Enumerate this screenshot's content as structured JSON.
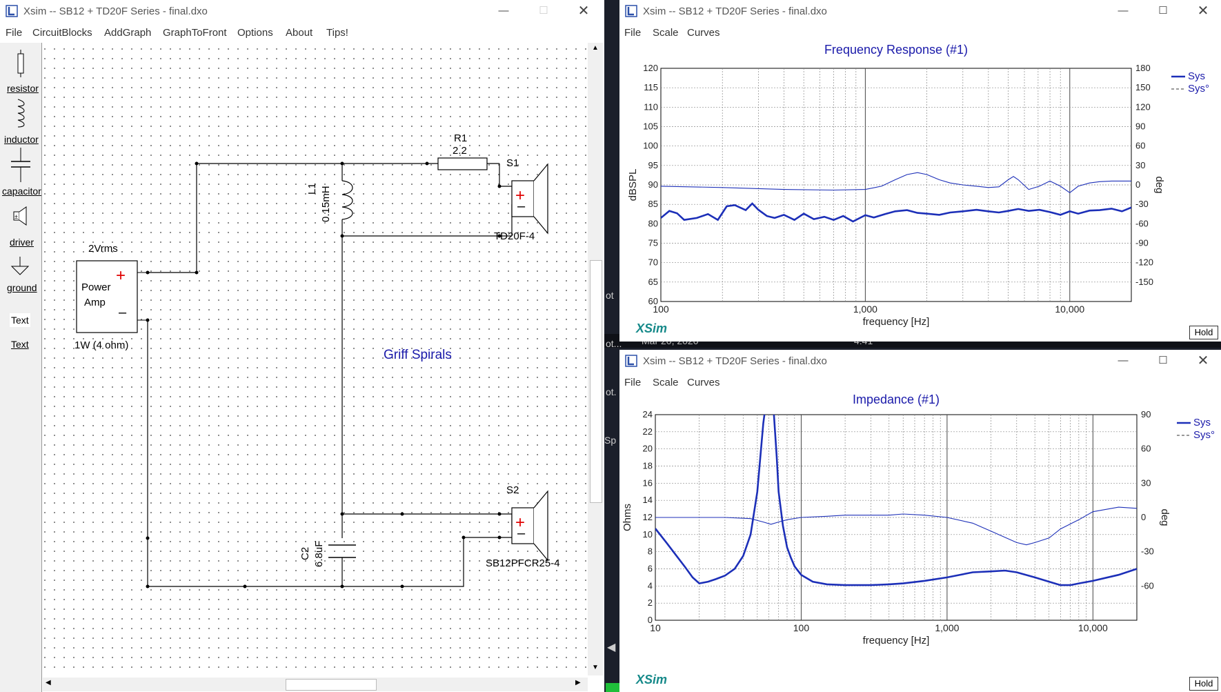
{
  "left_window": {
    "title": "Xsim -- SB12 + TD20F Series - final.dxo",
    "menu": [
      "File",
      "CircuitBlocks",
      "AddGraph",
      "GraphToFront",
      "Options",
      "About",
      "Tips!"
    ],
    "palette": [
      "resistor",
      "inductor",
      "capacitor",
      "driver",
      "ground",
      "Text",
      "Text"
    ],
    "circuit": {
      "r1_name": "R1",
      "r1_value": "2.2",
      "l1_name": "L1",
      "l1_value": "0.15mH",
      "c2_name": "C2",
      "c2_value": "6.8uF",
      "s1_name": "S1",
      "s1_model": "TD20F-4",
      "s2_name": "S2",
      "s2_model": "SB12PFCR25-4",
      "amp_voltage": "2Vrms",
      "amp_line1": "Power",
      "amp_line2": "Amp",
      "amp_power": "1W (4 ohm)",
      "plus": "+",
      "minus": "–",
      "annotation": "Griff Spirals"
    }
  },
  "freq_window": {
    "title": "Xsim -- SB12 + TD20F Series - final.dxo",
    "menu": [
      "File",
      "Scale",
      "Curves"
    ],
    "logo": "XSim",
    "hold": "Hold"
  },
  "imp_window": {
    "title": "Xsim -- SB12 + TD20F Series - final.dxo",
    "menu": [
      "File",
      "Scale",
      "Curves"
    ],
    "logo": "XSim",
    "hold": "Hold"
  },
  "background_text": {
    "date": "Mar 20, 2020",
    "time": "4:41",
    "frag1": "ot",
    "frag2": "ot...",
    "frag3": "ot.",
    "frag4": "Sp"
  },
  "colors": {
    "accent": "#1a1aaa",
    "curve": "#1c2fb8",
    "plus": "#e00000"
  },
  "chart_data": [
    {
      "type": "line",
      "title": "Frequency Response (#1)",
      "xlabel": "frequency [Hz]",
      "ylabel": "dBSPL",
      "y2label": "deg",
      "xscale": "log",
      "xlim": [
        100,
        20000
      ],
      "ylim": [
        60,
        120
      ],
      "y2lim": [
        -180,
        180
      ],
      "xticks": [
        {
          "v": 100,
          "label": "100"
        },
        {
          "v": 1000,
          "label": "1,000"
        },
        {
          "v": 10000,
          "label": "10,000"
        }
      ],
      "yticks": [
        60,
        65,
        70,
        75,
        80,
        85,
        90,
        95,
        100,
        105,
        110,
        115,
        120
      ],
      "y2ticks": [
        -150,
        -120,
        -90,
        -60,
        -30,
        0,
        30,
        60,
        90,
        120,
        150,
        180
      ],
      "grid": true,
      "legend": "top-right",
      "series": [
        {
          "name": "Sys",
          "axis": "left",
          "style": "solid",
          "x": [
            100,
            110,
            120,
            130,
            150,
            170,
            190,
            210,
            230,
            260,
            280,
            300,
            330,
            360,
            400,
            450,
            500,
            560,
            630,
            700,
            780,
            870,
            1000,
            1100,
            1250,
            1400,
            1600,
            1800,
            2000,
            2300,
            2600,
            3000,
            3500,
            4000,
            4500,
            5000,
            5600,
            6300,
            7100,
            8000,
            9000,
            10000,
            11000,
            12500,
            14000,
            16000,
            18000,
            20000
          ],
          "y": [
            81.5,
            83.3,
            82.7,
            81.0,
            81.5,
            82.5,
            81.0,
            84.5,
            84.8,
            83.5,
            85.2,
            83.6,
            82.0,
            81.5,
            82.3,
            81.0,
            82.6,
            81.2,
            81.8,
            81.0,
            82.0,
            80.6,
            82.2,
            81.6,
            82.5,
            83.2,
            83.5,
            82.8,
            82.6,
            82.3,
            82.9,
            83.2,
            83.6,
            83.2,
            82.9,
            83.3,
            83.8,
            83.3,
            83.6,
            83.0,
            82.3,
            83.2,
            82.6,
            83.4,
            83.5,
            83.9,
            83.2,
            84.2
          ]
        },
        {
          "name": "Sys°",
          "axis": "right",
          "style": "dashed",
          "x": [
            100,
            200,
            400,
            700,
            1000,
            1200,
            1400,
            1600,
            1800,
            2000,
            2300,
            2600,
            3000,
            3500,
            4000,
            4500,
            5000,
            5300,
            5600,
            6300,
            7100,
            8000,
            9000,
            10000,
            11000,
            12500,
            14000,
            16000,
            20000
          ],
          "y": [
            -2,
            -4,
            -7,
            -8,
            -7,
            -2,
            8,
            16,
            19,
            16,
            8,
            3,
            0,
            -2,
            -4,
            -3,
            8,
            13,
            8,
            -7,
            -2,
            6,
            -2,
            -12,
            -2,
            3,
            5,
            6,
            6
          ]
        }
      ]
    },
    {
      "type": "line",
      "title": "Impedance (#1)",
      "xlabel": "frequency [Hz]",
      "ylabel": "Ohms",
      "y2label": "deg",
      "xscale": "log",
      "xlim": [
        10,
        20000
      ],
      "ylim": [
        0,
        24
      ],
      "y2lim": [
        -90,
        90
      ],
      "xticks": [
        {
          "v": 10,
          "label": "10"
        },
        {
          "v": 100,
          "label": "100"
        },
        {
          "v": 1000,
          "label": "1,000"
        },
        {
          "v": 10000,
          "label": "10,000"
        }
      ],
      "yticks": [
        0,
        2,
        4,
        6,
        8,
        10,
        12,
        14,
        16,
        18,
        20,
        22,
        24
      ],
      "y2ticks": [
        -60,
        -30,
        0,
        30,
        60,
        90
      ],
      "grid": true,
      "legend": "top-right",
      "series": [
        {
          "name": "Sys",
          "axis": "left",
          "style": "solid",
          "x": [
            10,
            12,
            14,
            16,
            18,
            20,
            23,
            26,
            30,
            35,
            40,
            45,
            50,
            55,
            58,
            60,
            62,
            65,
            68,
            70,
            75,
            80,
            85,
            90,
            100,
            120,
            150,
            200,
            300,
            400,
            500,
            700,
            1000,
            1500,
            2000,
            2500,
            3000,
            4000,
            5000,
            6000,
            7000,
            8000,
            10000,
            15000,
            20000
          ],
          "y": [
            10.7,
            9.0,
            7.5,
            6.2,
            5.0,
            4.3,
            4.5,
            4.8,
            5.2,
            6.0,
            7.5,
            10.0,
            15.0,
            23.0,
            26.0,
            27.0,
            26.0,
            24.0,
            19.0,
            15.0,
            11.0,
            8.5,
            7.3,
            6.3,
            5.3,
            4.5,
            4.2,
            4.1,
            4.1,
            4.2,
            4.3,
            4.6,
            5.0,
            5.6,
            5.7,
            5.8,
            5.6,
            5.0,
            4.5,
            4.1,
            4.1,
            4.3,
            4.6,
            5.3,
            6.0
          ]
        },
        {
          "name": "Sys°",
          "axis": "right",
          "style": "dashed",
          "x": [
            10,
            20,
            30,
            45,
            55,
            62,
            70,
            80,
            100,
            150,
            200,
            300,
            400,
            500,
            700,
            1000,
            1500,
            2000,
            3000,
            3500,
            4000,
            5000,
            6000,
            8000,
            10000,
            15000,
            20000
          ],
          "y": [
            0,
            0,
            0,
            -1,
            -4,
            -6,
            -4,
            -2,
            0,
            1,
            2,
            2,
            2,
            3,
            2,
            0,
            -5,
            -12,
            -22,
            -24,
            -22,
            -18,
            -10,
            -2,
            5,
            9,
            8
          ]
        }
      ]
    }
  ]
}
